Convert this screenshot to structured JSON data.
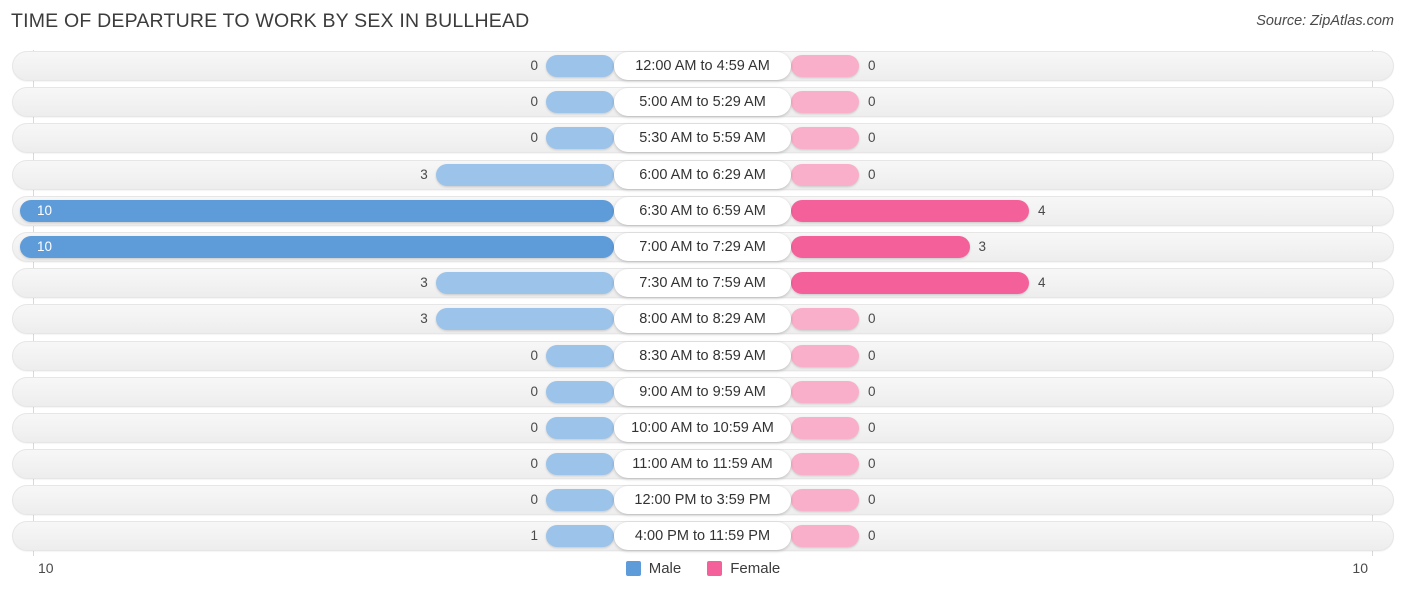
{
  "header": {
    "title": "TIME OF DEPARTURE TO WORK BY SEX IN BULLHEAD",
    "source": "Source: ZipAtlas.com"
  },
  "legend": {
    "male_label": "Male",
    "female_label": "Female",
    "male_color": "#5e9bd9",
    "female_color": "#f4619a"
  },
  "axis": {
    "left_max_label": "10",
    "right_max_label": "10"
  },
  "chart_data": {
    "type": "bar",
    "orientation": "horizontal-diverging",
    "title": "TIME OF DEPARTURE TO WORK BY SEX IN BULLHEAD",
    "xlabel": "",
    "ylabel": "",
    "xlim": [
      10,
      10
    ],
    "grid": true,
    "legend_position": "bottom-center",
    "categories": [
      "12:00 AM to 4:59 AM",
      "5:00 AM to 5:29 AM",
      "5:30 AM to 5:59 AM",
      "6:00 AM to 6:29 AM",
      "6:30 AM to 6:59 AM",
      "7:00 AM to 7:29 AM",
      "7:30 AM to 7:59 AM",
      "8:00 AM to 8:29 AM",
      "8:30 AM to 8:59 AM",
      "9:00 AM to 9:59 AM",
      "10:00 AM to 10:59 AM",
      "11:00 AM to 11:59 AM",
      "12:00 PM to 3:59 PM",
      "4:00 PM to 11:59 PM"
    ],
    "series": [
      {
        "name": "Male",
        "values": [
          0,
          0,
          0,
          3,
          10,
          10,
          3,
          3,
          0,
          0,
          0,
          0,
          0,
          1
        ]
      },
      {
        "name": "Female",
        "values": [
          0,
          0,
          0,
          0,
          4,
          3,
          4,
          0,
          0,
          0,
          0,
          0,
          0,
          0
        ]
      }
    ]
  },
  "rows": [
    {
      "category": "12:00 AM to 4:59 AM",
      "male": "0",
      "female": "0"
    },
    {
      "category": "5:00 AM to 5:29 AM",
      "male": "0",
      "female": "0"
    },
    {
      "category": "5:30 AM to 5:59 AM",
      "male": "0",
      "female": "0"
    },
    {
      "category": "6:00 AM to 6:29 AM",
      "male": "3",
      "female": "0"
    },
    {
      "category": "6:30 AM to 6:59 AM",
      "male": "10",
      "female": "4"
    },
    {
      "category": "7:00 AM to 7:29 AM",
      "male": "10",
      "female": "3"
    },
    {
      "category": "7:30 AM to 7:59 AM",
      "male": "3",
      "female": "4"
    },
    {
      "category": "8:00 AM to 8:29 AM",
      "male": "3",
      "female": "0"
    },
    {
      "category": "8:30 AM to 8:59 AM",
      "male": "0",
      "female": "0"
    },
    {
      "category": "9:00 AM to 9:59 AM",
      "male": "0",
      "female": "0"
    },
    {
      "category": "10:00 AM to 10:59 AM",
      "male": "0",
      "female": "0"
    },
    {
      "category": "11:00 AM to 11:59 AM",
      "male": "0",
      "female": "0"
    },
    {
      "category": "12:00 PM to 3:59 PM",
      "male": "0",
      "female": "0"
    },
    {
      "category": "4:00 PM to 11:59 PM",
      "male": "1",
      "female": "0"
    }
  ]
}
